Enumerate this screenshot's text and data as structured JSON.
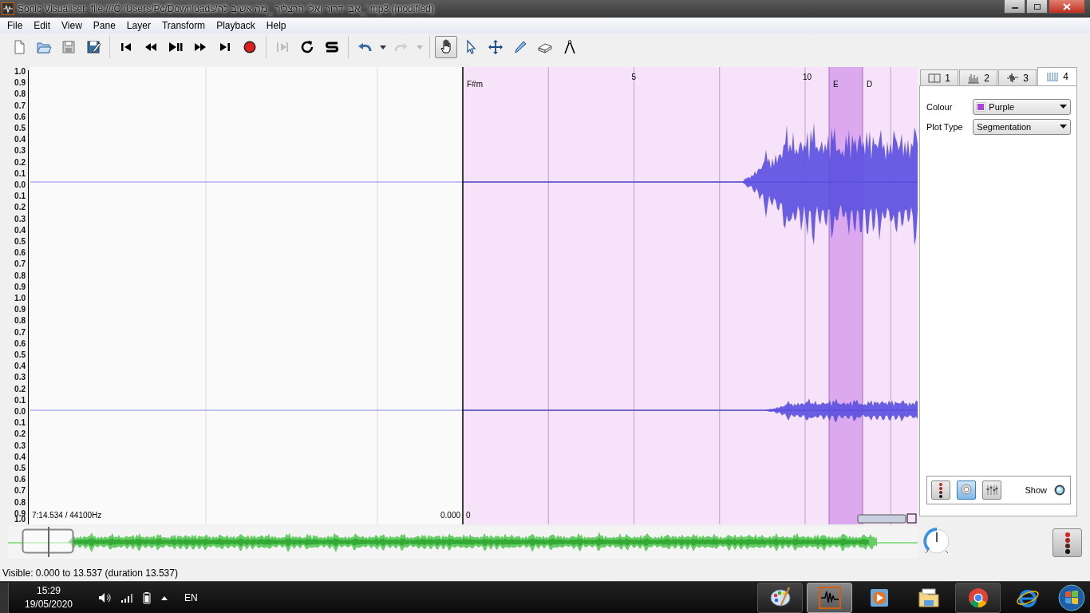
{
  "window": {
    "title": "Sonic Visualiser: file:///C:/Users/Pc/Downloads/אבי דרור ואלי הרצליך _מה אשיב לה_'.mp3 (modified)"
  },
  "menu": [
    "File",
    "Edit",
    "View",
    "Pane",
    "Layer",
    "Transform",
    "Playback",
    "Help"
  ],
  "toolbar": [
    [
      {
        "kind": "new",
        "disabled": false,
        "selected": false
      },
      {
        "kind": "open",
        "disabled": false,
        "selected": false
      },
      {
        "kind": "save",
        "disabled": false,
        "selected": false
      },
      {
        "kind": "saveas",
        "disabled": false,
        "selected": false
      }
    ],
    [
      {
        "kind": "start",
        "disabled": false,
        "selected": false
      },
      {
        "kind": "rewind",
        "disabled": false,
        "selected": false
      },
      {
        "kind": "playpause",
        "disabled": false,
        "selected": false
      },
      {
        "kind": "forward",
        "disabled": false,
        "selected": false
      },
      {
        "kind": "end",
        "disabled": false,
        "selected": false
      },
      {
        "kind": "record",
        "disabled": false,
        "selected": false
      }
    ],
    [
      {
        "kind": "playsel",
        "disabled": true,
        "selected": false
      },
      {
        "kind": "loop",
        "disabled": false,
        "selected": false
      },
      {
        "kind": "solo",
        "disabled": false,
        "selected": false
      }
    ],
    [
      {
        "kind": "undo",
        "disabled": false,
        "selected": false
      },
      {
        "kind": "caret",
        "disabled": false,
        "selected": false
      },
      {
        "kind": "redo",
        "disabled": true,
        "selected": false
      },
      {
        "kind": "caret",
        "disabled": true,
        "selected": false
      }
    ],
    [
      {
        "kind": "navigate",
        "disabled": false,
        "selected": true
      },
      {
        "kind": "select",
        "disabled": false,
        "selected": false
      },
      {
        "kind": "move",
        "disabled": false,
        "selected": false
      },
      {
        "kind": "draw",
        "disabled": false,
        "selected": false
      },
      {
        "kind": "erase",
        "disabled": false,
        "selected": false
      },
      {
        "kind": "measure",
        "disabled": false,
        "selected": false
      }
    ]
  ],
  "pane": {
    "scale_labels": [
      "1.0",
      "0.9",
      "0.8",
      "0.7",
      "0.6",
      "0.5",
      "0.4",
      "0.3",
      "0.2",
      "0.1",
      "0.0",
      "0.1",
      "0.2",
      "0.3",
      "0.4",
      "0.5",
      "0.6",
      "0.7",
      "0.8",
      "0.9",
      "1.0",
      "0.9",
      "0.8",
      "0.7",
      "0.6",
      "0.5",
      "0.4",
      "0.3",
      "0.2",
      "0.1",
      "0.0",
      "0.1",
      "0.2",
      "0.3",
      "0.4",
      "0.5",
      "0.6",
      "0.7",
      "0.8",
      "0.9",
      "1.0"
    ],
    "ruler_labels": [
      "5",
      "10"
    ],
    "segments": [
      {
        "label": "F#m",
        "selected": false
      },
      {
        "label": "E",
        "selected": true
      },
      {
        "label": "D",
        "selected": false
      }
    ],
    "file_info": "7:14.534 / 44100Hz",
    "start_time": "0.000",
    "origin_label": "0"
  },
  "layer_tabs": [
    {
      "label": "1",
      "kind": "pane",
      "selected": false
    },
    {
      "label": "2",
      "kind": "ruler",
      "selected": false
    },
    {
      "label": "3",
      "kind": "waveform",
      "selected": false
    },
    {
      "label": "4",
      "kind": "segments",
      "selected": true
    }
  ],
  "properties": {
    "colour_label": "Colour",
    "colour": {
      "value": "Purple",
      "color": "#b040e0"
    },
    "plot_type_label": "Plot Type",
    "plot_type": "Segmentation",
    "buttons": [
      {
        "kind": "meter",
        "selected": false
      },
      {
        "kind": "dial",
        "selected": true
      },
      {
        "kind": "sliders",
        "selected": false
      }
    ],
    "show_label": "Show",
    "show": true
  },
  "status": "Visible: 0.000 to 13.537 (duration 13.537)",
  "taskbar": {
    "time": "15:29",
    "date": "19/05/2020",
    "language": "EN",
    "apps": [
      {
        "kind": "paint",
        "running": true,
        "active": false
      },
      {
        "kind": "sonic",
        "running": true,
        "active": true
      },
      {
        "kind": "media",
        "running": false,
        "active": false
      },
      {
        "kind": "folder",
        "running": false,
        "active": false
      },
      {
        "kind": "chrome",
        "running": true,
        "active": false
      },
      {
        "kind": "ie",
        "running": false,
        "active": false
      }
    ]
  }
}
